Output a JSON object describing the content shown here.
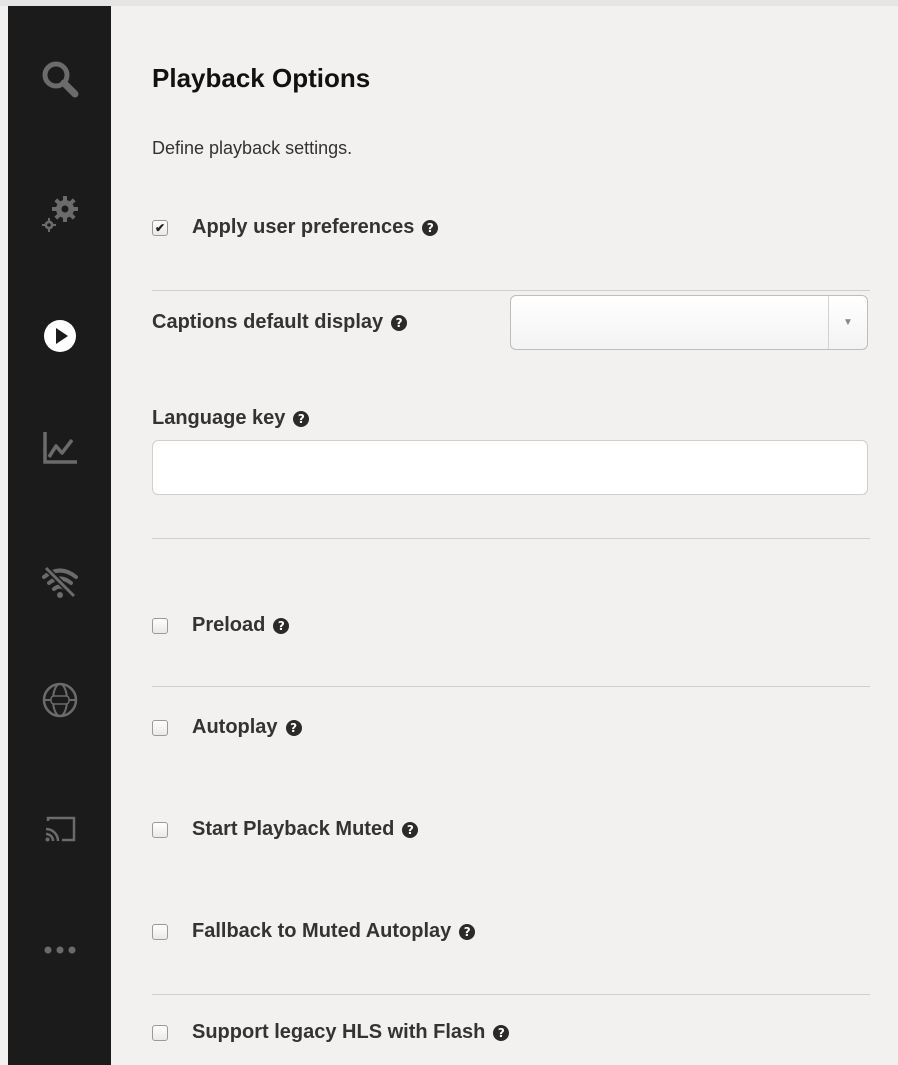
{
  "sidebar": {
    "items": [
      {
        "name": "search-icon"
      },
      {
        "name": "gears-icon"
      },
      {
        "name": "play-circle-icon"
      },
      {
        "name": "analytics-chart-icon"
      },
      {
        "name": "wifi-off-icon"
      },
      {
        "name": "globe-360-icon"
      },
      {
        "name": "cast-icon"
      },
      {
        "name": "more-dots-icon"
      }
    ],
    "active_index": 2
  },
  "main": {
    "title": "Playback Options",
    "description": "Define playback settings.",
    "apply_user_preferences": {
      "label": "Apply user preferences",
      "checked": true
    },
    "captions_default_display": {
      "label": "Captions default display",
      "value": ""
    },
    "language_key": {
      "label": "Language key",
      "value": "",
      "placeholder": ""
    },
    "preload": {
      "label": "Preload",
      "checked": false
    },
    "autoplay": {
      "label": "Autoplay",
      "checked": false
    },
    "start_playback_muted": {
      "label": "Start Playback Muted",
      "checked": false
    },
    "fallback_muted_autoplay": {
      "label": "Fallback to Muted Autoplay",
      "checked": false
    },
    "support_legacy_hls": {
      "label": "Support legacy HLS with Flash",
      "checked": false
    },
    "help_glyph": "?"
  },
  "colors": {
    "sidebar_bg": "#1b1b1b",
    "icon_inactive": "#6b6b6b",
    "icon_active": "#ffffff",
    "content_bg": "#f2f1ef"
  }
}
